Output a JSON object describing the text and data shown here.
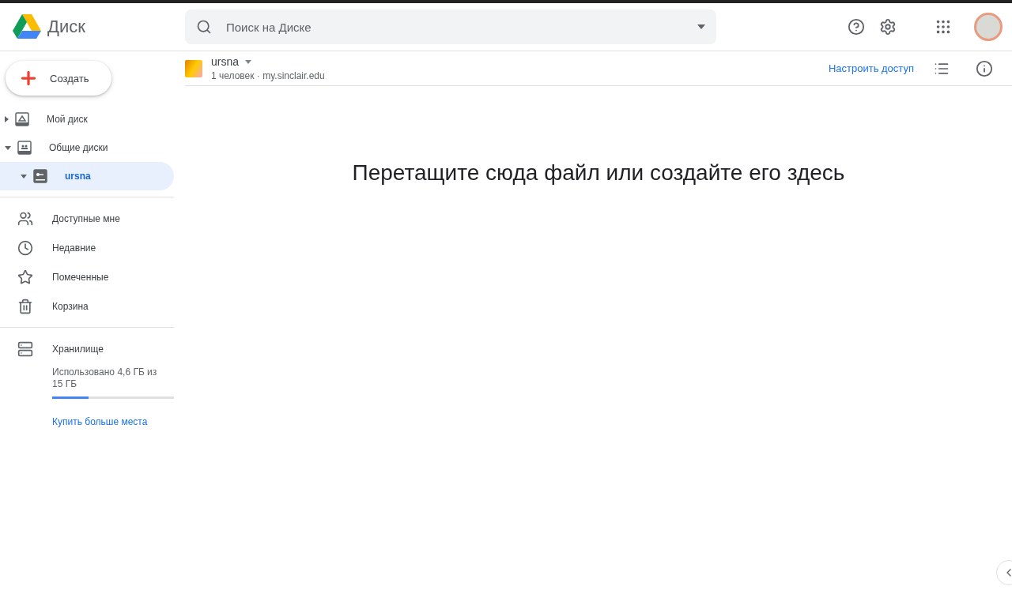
{
  "app": {
    "title": "Диск"
  },
  "search": {
    "placeholder": "Поиск на Диске"
  },
  "create_button": "Создать",
  "nav_tree": [
    {
      "label": "Мой диск",
      "expanded": false,
      "selected": false
    },
    {
      "label": "Общие диски",
      "expanded": true,
      "selected": false,
      "children": [
        {
          "label": "ursna",
          "expanded": true,
          "selected": true
        }
      ]
    }
  ],
  "nav_items": [
    {
      "label": "Доступные мне"
    },
    {
      "label": "Недавние"
    },
    {
      "label": "Помеченные"
    },
    {
      "label": "Корзина"
    }
  ],
  "storage": {
    "label": "Хранилище",
    "usage": "Использовано 4,6 ГБ из 15 ГБ",
    "level": 0.3,
    "buy_link": "Купить больше места"
  },
  "folder": {
    "name": "ursna",
    "members": "1 человек",
    "separator": "·",
    "domain": "my.sinclair.edu",
    "share_link": "Настроить доступ"
  },
  "empty_message": "Перетащите сюда файл или создайте его здесь"
}
